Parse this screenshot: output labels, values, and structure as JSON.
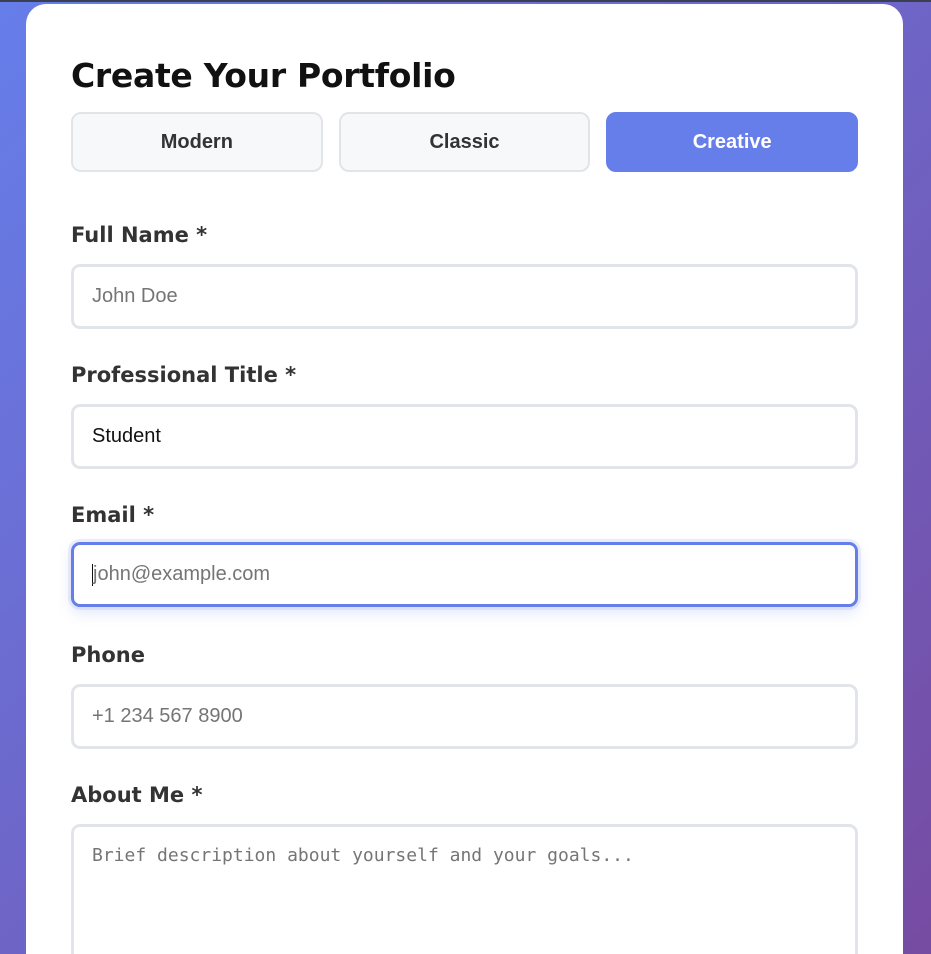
{
  "form": {
    "title": "Create Your Portfolio",
    "templates": [
      {
        "label": "Modern",
        "active": false
      },
      {
        "label": "Classic",
        "active": false
      },
      {
        "label": "Creative",
        "active": true
      }
    ],
    "fields": {
      "full_name": {
        "label": "Full Name *",
        "placeholder": "John Doe",
        "value": ""
      },
      "professional_title": {
        "label": "Professional Title *",
        "placeholder": "",
        "value": "Student"
      },
      "email": {
        "label": "Email *",
        "placeholder": "john@example.com",
        "value": "",
        "focused": true
      },
      "phone": {
        "label": "Phone",
        "placeholder": "+1 234 567 8900",
        "value": ""
      },
      "about_me": {
        "label": "About Me *",
        "placeholder": "Brief description about yourself and your goals...",
        "value": ""
      }
    }
  },
  "colors": {
    "background_gradient_start": "#667eea",
    "background_gradient_end": "#764ba2",
    "accent": "#667eea",
    "input_border": "#e1e5ea",
    "placeholder_text": "#757575"
  }
}
